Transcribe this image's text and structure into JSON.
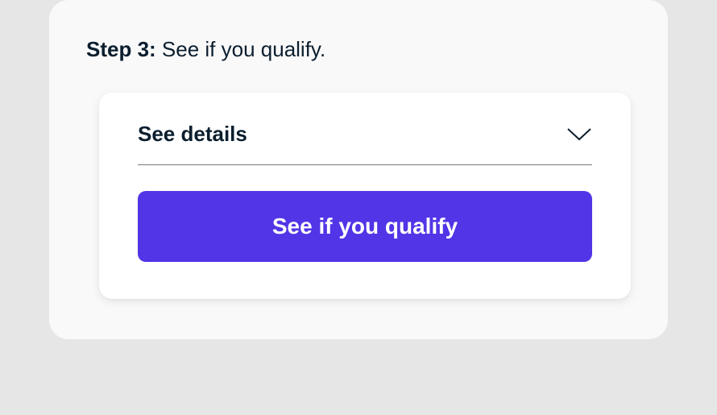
{
  "step": {
    "label": "Step 3:",
    "title": "See if you qualify."
  },
  "details": {
    "toggle_label": "See details"
  },
  "cta": {
    "label": "See if you qualify"
  },
  "colors": {
    "accent": "#5135e7"
  }
}
